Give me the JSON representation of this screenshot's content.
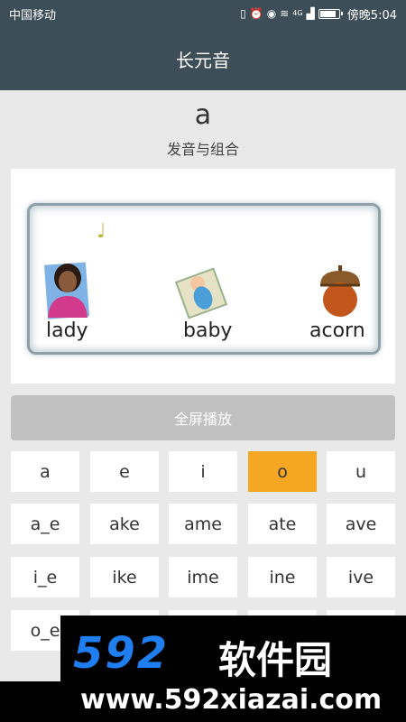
{
  "status_bar": {
    "carrier": "中国移动",
    "network": "4G",
    "time": "傍晚5:04",
    "battery_level": 0.9
  },
  "app_bar": {
    "title": "长元音"
  },
  "header": {
    "letter": "a",
    "subtitle": "发音与组合"
  },
  "picture": {
    "words": [
      "lady",
      "baby",
      "acorn"
    ],
    "icons": [
      "music-note-icon",
      "lady-illustration",
      "baby-illustration",
      "acorn-illustration"
    ]
  },
  "play_button": {
    "label": "全屏播放"
  },
  "keys": [
    [
      "a",
      "e",
      "i",
      "o",
      "u"
    ],
    [
      "a_e",
      "ake",
      "ame",
      "ate",
      "ave"
    ],
    [
      "i_e",
      "ike",
      "ime",
      "ine",
      "ive"
    ],
    [
      "o_e",
      "",
      "",
      "",
      ""
    ]
  ],
  "selected_key": "o",
  "colors": {
    "appbar": "#3e4e58",
    "accent": "#f5a623",
    "watermark_blue": "#1f7ef0"
  },
  "watermark": {
    "logo": "592",
    "brand": "软件园",
    "url": "www.592xiazai.com"
  }
}
